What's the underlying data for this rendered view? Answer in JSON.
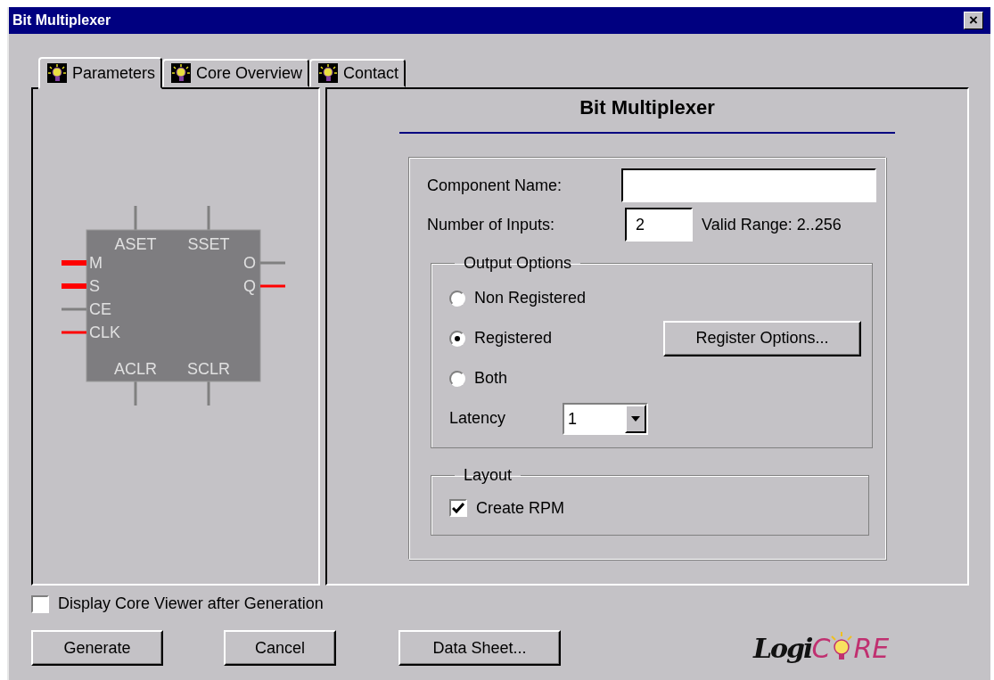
{
  "window": {
    "title": "Bit Multiplexer",
    "close": "×"
  },
  "tabs": [
    {
      "label": "Parameters",
      "selected": true
    },
    {
      "label": "Core Overview",
      "selected": false
    },
    {
      "label": "Contact",
      "selected": false
    }
  ],
  "symbol": {
    "top": [
      "ASET",
      "SSET"
    ],
    "bottom": [
      "ACLR",
      "SCLR"
    ],
    "left_pins": [
      {
        "name": "M",
        "color": "#ff0000",
        "kind": "bus"
      },
      {
        "name": "S",
        "color": "#ff0000",
        "kind": "bus"
      },
      {
        "name": "CE",
        "color": "#808080",
        "kind": "wire"
      },
      {
        "name": "CLK",
        "color": "#ff0000",
        "kind": "wire"
      }
    ],
    "right_pins": [
      {
        "name": "O",
        "color": "#808080"
      },
      {
        "name": "Q",
        "color": "#ff0000"
      }
    ]
  },
  "heading": "Bit Multiplexer",
  "component_name": {
    "label": "Component Name:"
  },
  "number_of_inputs": {
    "label": "Number of Inputs:",
    "value": "2",
    "hint": "Valid Range: 2..256"
  },
  "output_options": {
    "title": "Output Options",
    "radios": [
      {
        "label": "Non Registered",
        "selected": false
      },
      {
        "label": "Registered",
        "selected": true
      },
      {
        "label": "Both",
        "selected": false
      }
    ],
    "register_button": "Register Options...",
    "latency": {
      "label": "Latency",
      "value": "1"
    }
  },
  "layout": {
    "title": "Layout",
    "create_rpm": {
      "label": "Create RPM",
      "checked": true
    }
  },
  "display_viewer": {
    "label": "Display Core Viewer after Generation",
    "checked": false
  },
  "buttons": [
    "Generate",
    "Cancel",
    "Data Sheet..."
  ],
  "logo": {
    "left": "Logi",
    "c": "C",
    "right": "RE"
  }
}
